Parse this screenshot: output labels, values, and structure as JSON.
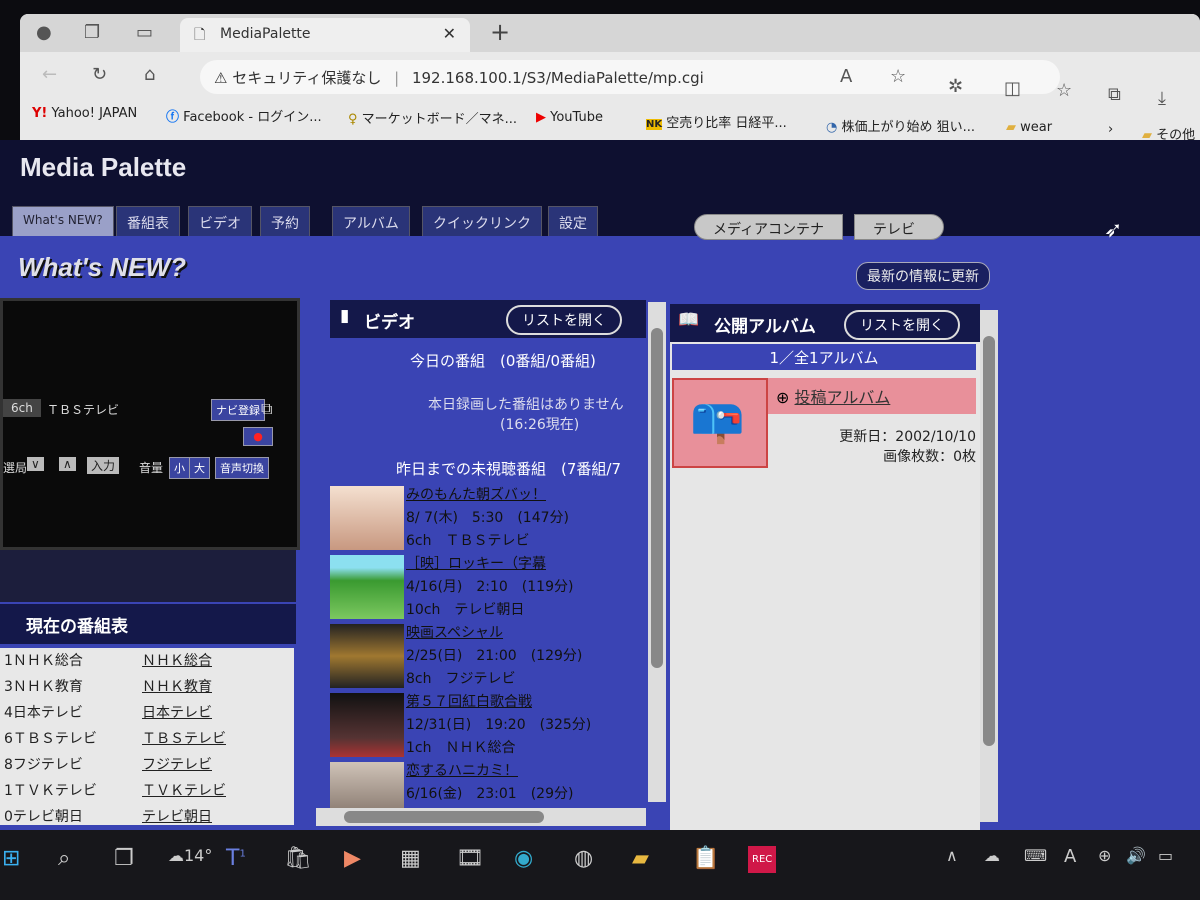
{
  "browser": {
    "tab_title": "MediaPalette",
    "security": "セキュリティ保護なし",
    "url": "192.168.100.1/S3/MediaPalette/mp.cgi",
    "bookmarks": [
      "Yahoo! JAPAN",
      "Facebook - ログイン...",
      "マーケットボード／マネ...",
      "YouTube",
      "空売り比率 日経平...",
      "株価上がり始め 狙い...",
      "wear",
      "その他"
    ]
  },
  "app": {
    "logo": "Media Palette",
    "tabs": [
      "What's NEW?",
      "番組表",
      "ビデオ",
      "予約",
      "アルバム",
      "クイックリンク",
      "設定"
    ],
    "active_tab": "What's NEW?",
    "source_toggle": [
      "メディアコンテナ",
      "テレビ"
    ],
    "page_title": "What's NEW?",
    "refresh_button": "最新の情報に更新"
  },
  "tv": {
    "channel": "6ch",
    "station": "ＴＢＳテレビ",
    "navi_button": "ナビ登録",
    "select_label": "選局",
    "input_button": "入力",
    "volume_label": "音量",
    "vol_small": "小",
    "vol_large": "大",
    "audio_button": "音声切換"
  },
  "guide": {
    "title": "現在の番組表",
    "rows": [
      [
        "1ＮＨＫ総合",
        "ＮＨＫ総合"
      ],
      [
        "3ＮＨＫ教育",
        "ＮＨＫ教育"
      ],
      [
        "4日本テレビ",
        "日本テレビ"
      ],
      [
        "6ＴＢＳテレビ",
        "ＴＢＳテレビ"
      ],
      [
        "8フジテレビ",
        "フジテレビ"
      ],
      [
        "1ＴＶＫテレビ",
        "ＴＶＫテレビ"
      ],
      [
        "0テレビ朝日",
        "テレビ朝日"
      ]
    ]
  },
  "video": {
    "title": "ビデオ",
    "open_list": "リストを開く",
    "today": "今日の番組　(0番組/0番組)",
    "none": "本日録画した番組はありません",
    "as_of": "(16:26現在)",
    "unwatched": "昨日までの未視聴番組　(7番組/7",
    "items": [
      {
        "title": "みのもんた朝ズバッ！",
        "time": "8/ 7(木)　5:30　(147分)",
        "channel": "6ch　ＴＢＳテレビ"
      },
      {
        "title": "［映］ロッキー（字幕",
        "time": "4/16(月)　2:10　(119分)",
        "channel": "10ch　テレビ朝日"
      },
      {
        "title": "映画スペシャル",
        "time": "2/25(日)　21:00　(129分)",
        "channel": "8ch　フジテレビ"
      },
      {
        "title": "第５７回紅白歌合戦",
        "time": "12/31(日)　19:20　(325分)",
        "channel": "1ch　ＮＨＫ総合"
      },
      {
        "title": "恋するハニカミ！",
        "time": "6/16(金)　23:01　(29分)",
        "channel": ""
      }
    ]
  },
  "album": {
    "title": "公開アルバム",
    "open_list": "リストを開く",
    "count": "1／全1アルバム",
    "name": "投稿アルバム",
    "updated": "更新日：2002/10/10",
    "images": "画像枚数：0枚"
  },
  "taskbar": {
    "weather": "14°",
    "teams_badge": "1",
    "rec": "REC"
  },
  "colors": {
    "page_bg": "#3a44b4",
    "header": "#0e1030",
    "album_item": "#e8909a"
  }
}
